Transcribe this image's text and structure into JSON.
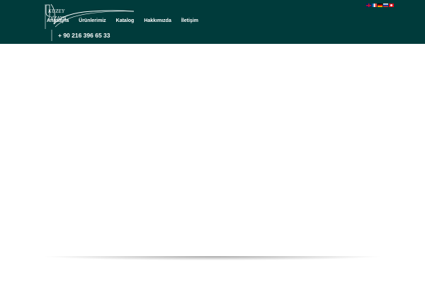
{
  "brand": {
    "line1": "KUZEY",
    "line2": "DİZAYN"
  },
  "nav": {
    "items": [
      {
        "label": "Anasayfa"
      },
      {
        "label": "Ürünlerimiz"
      },
      {
        "label": "Katalog"
      },
      {
        "label": "Hakkımızda"
      },
      {
        "label": "İletişim"
      }
    ]
  },
  "contact": {
    "phone": "+ 90 216 396 65 33"
  },
  "languages": [
    {
      "code": "en",
      "icon": "uk-flag-icon"
    },
    {
      "code": "fr",
      "icon": "france-flag-icon"
    },
    {
      "code": "de",
      "icon": "germany-flag-icon"
    },
    {
      "code": "ru",
      "icon": "russia-flag-icon"
    },
    {
      "code": "tr",
      "icon": "turkey-flag-icon"
    }
  ],
  "colors": {
    "header_bg": "#003b3b",
    "text": "#ffffff"
  }
}
